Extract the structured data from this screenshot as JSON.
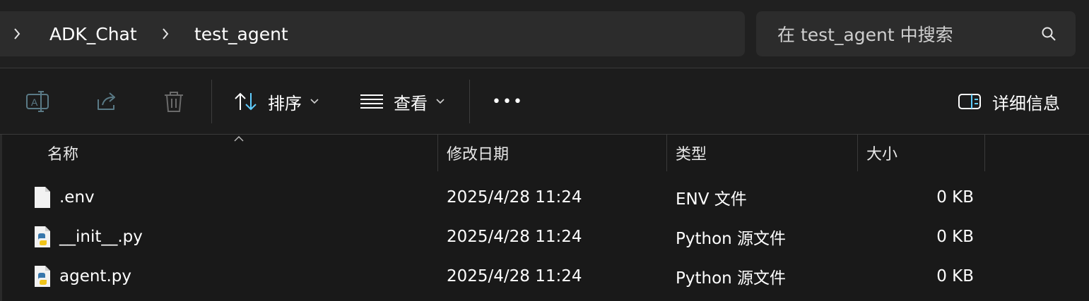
{
  "breadcrumb": {
    "items": [
      "ADK_Chat",
      "test_agent"
    ]
  },
  "search": {
    "placeholder": "在 test_agent 中搜索"
  },
  "toolbar": {
    "sort_label": "排序",
    "view_label": "查看",
    "more_label": "•••",
    "details_label": "详细信息"
  },
  "columns": {
    "name": "名称",
    "date": "修改日期",
    "type": "类型",
    "size": "大小"
  },
  "files": [
    {
      "name": ".env",
      "date": "2025/4/28 11:24",
      "type": "ENV 文件",
      "size": "0 KB",
      "icon": "file-icon"
    },
    {
      "name": "__init__.py",
      "date": "2025/4/28 11:24",
      "type": "Python 源文件",
      "size": "0 KB",
      "icon": "python-file-icon"
    },
    {
      "name": "agent.py",
      "date": "2025/4/28 11:24",
      "type": "Python 源文件",
      "size": "0 KB",
      "icon": "python-file-icon"
    }
  ],
  "colors": {
    "background": "#191919",
    "panel": "#2c2c2c",
    "accent": "#60cdff"
  }
}
